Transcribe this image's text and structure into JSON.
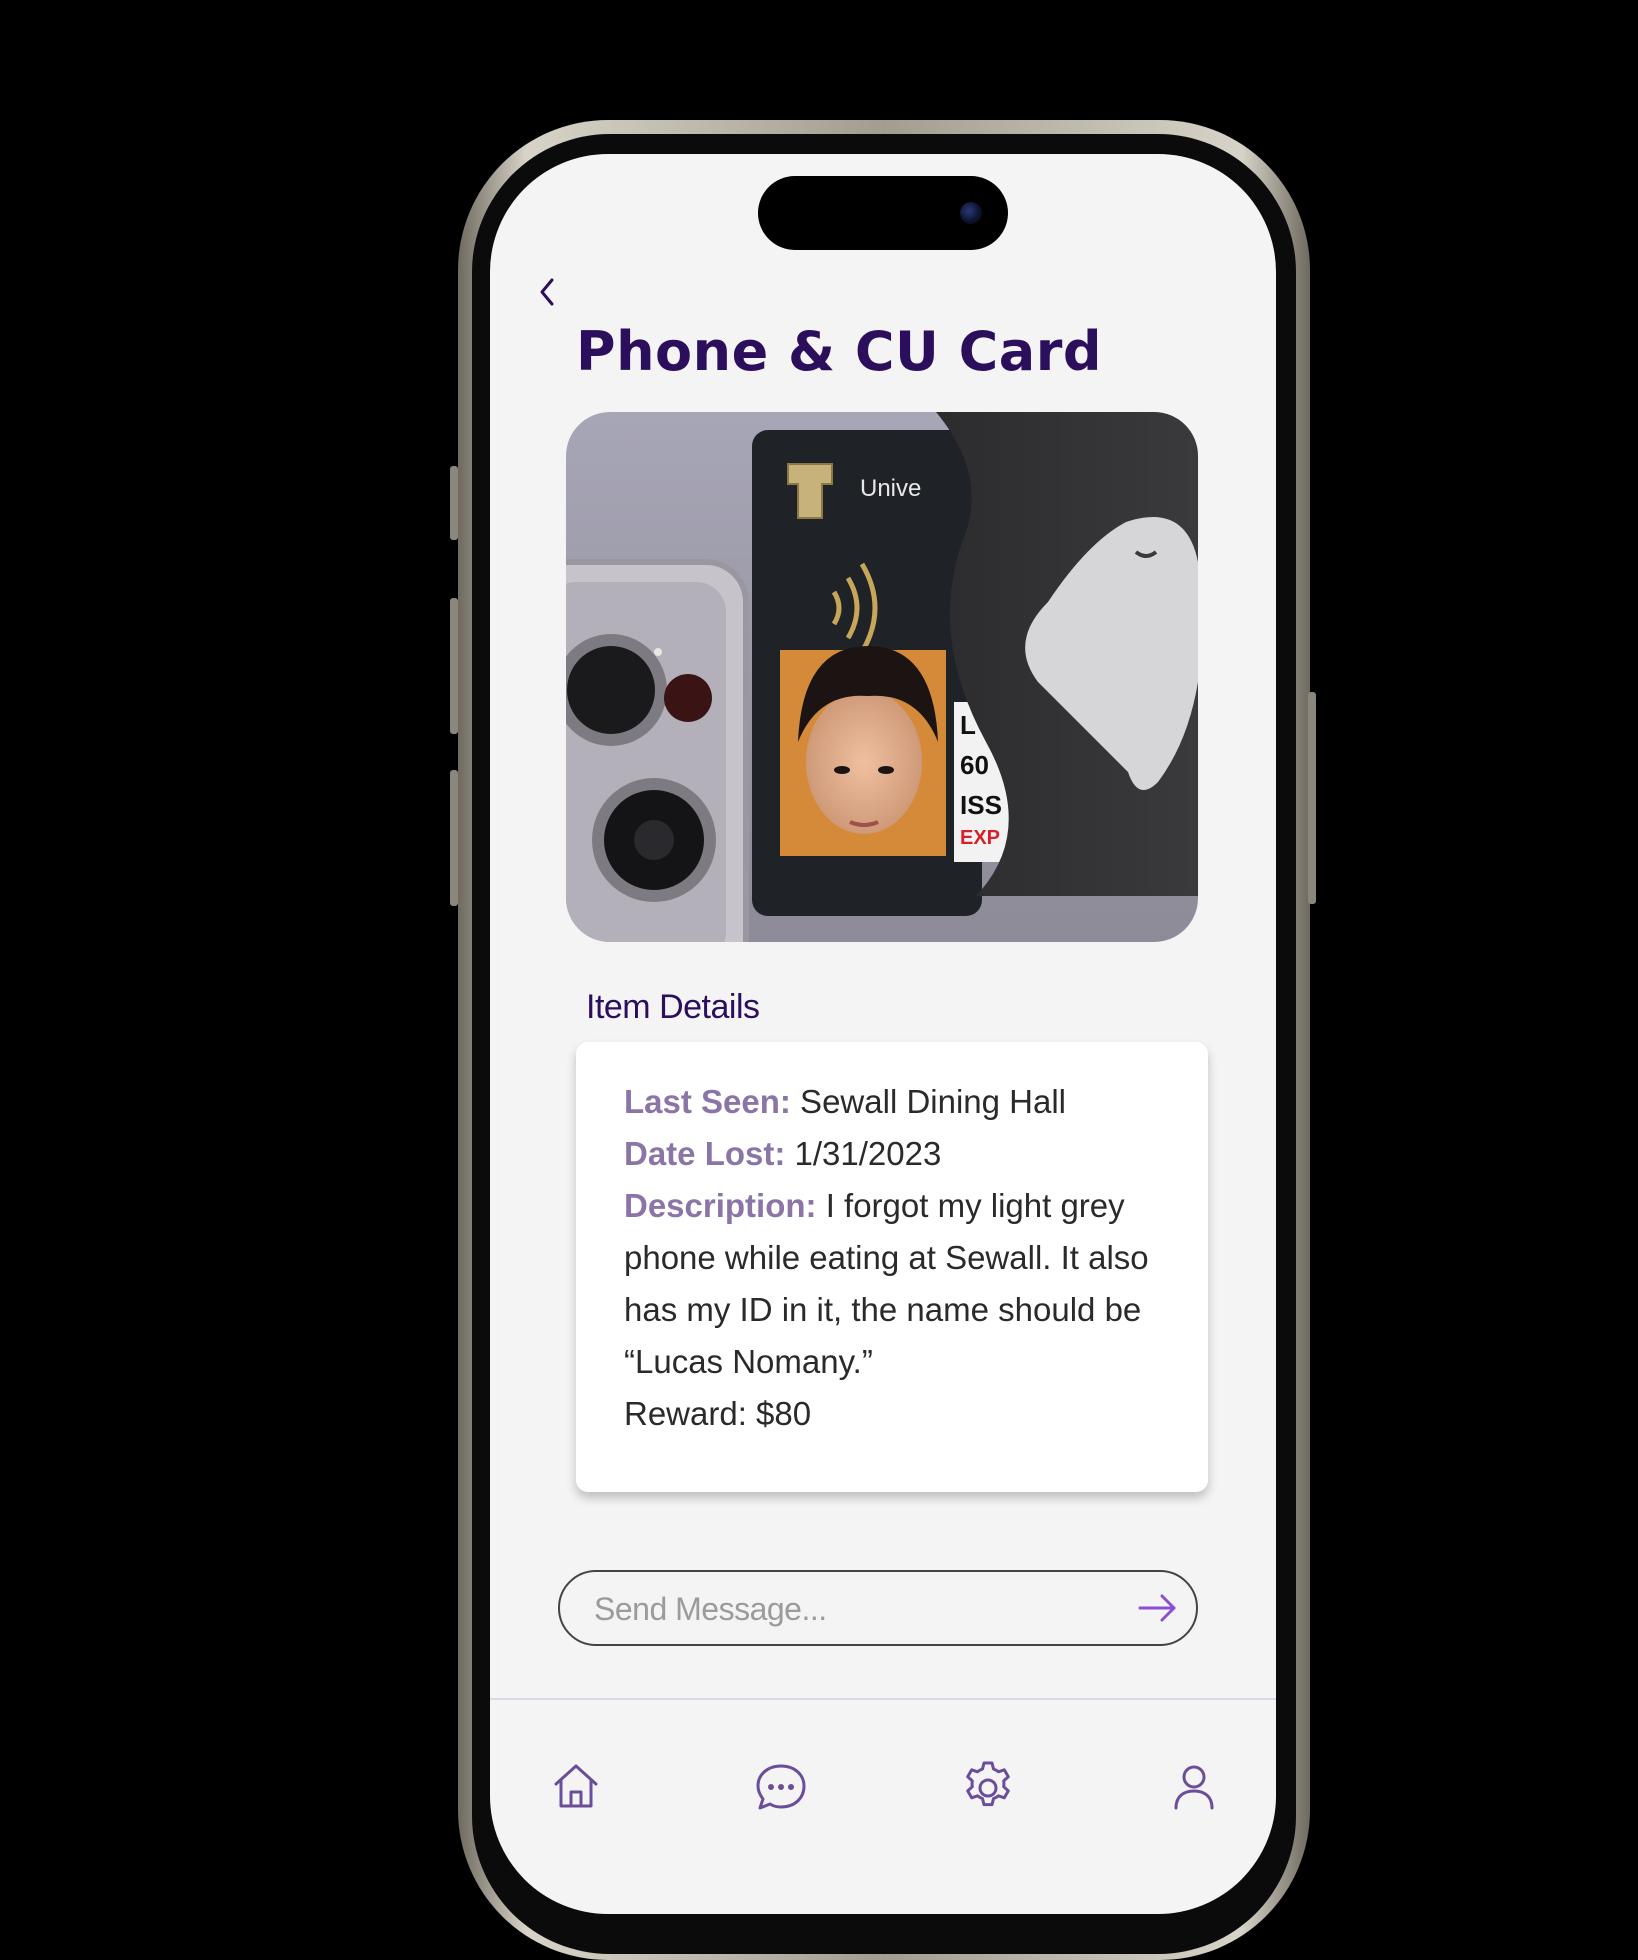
{
  "header": {
    "title": "Phone & CU Card"
  },
  "photo": {
    "card_text": "Unive",
    "id_lines": [
      "L",
      "60",
      "ISS",
      "EXP"
    ]
  },
  "details": {
    "section_title": "Item Details",
    "last_seen_label": "Last Seen:",
    "last_seen_value": " Sewall Dining Hall",
    "date_lost_label": "Date Lost:",
    "date_lost_value": " 1/31/2023",
    "description_label": "Description:",
    "description_value": " I forgot my light grey phone while eating at Sewall. It also has my ID in it, the name should be “Lucas Nomany.”",
    "reward": "Reward: $80"
  },
  "message": {
    "placeholder": "Send Message..."
  },
  "tabbar": {
    "items": [
      "home-icon",
      "chat-icon",
      "settings-icon",
      "profile-icon"
    ]
  },
  "colors": {
    "title": "#2b0e5c",
    "label": "#8a75a6",
    "send_arrow": "#8a4fd6",
    "icon": "#6b4e9a"
  }
}
